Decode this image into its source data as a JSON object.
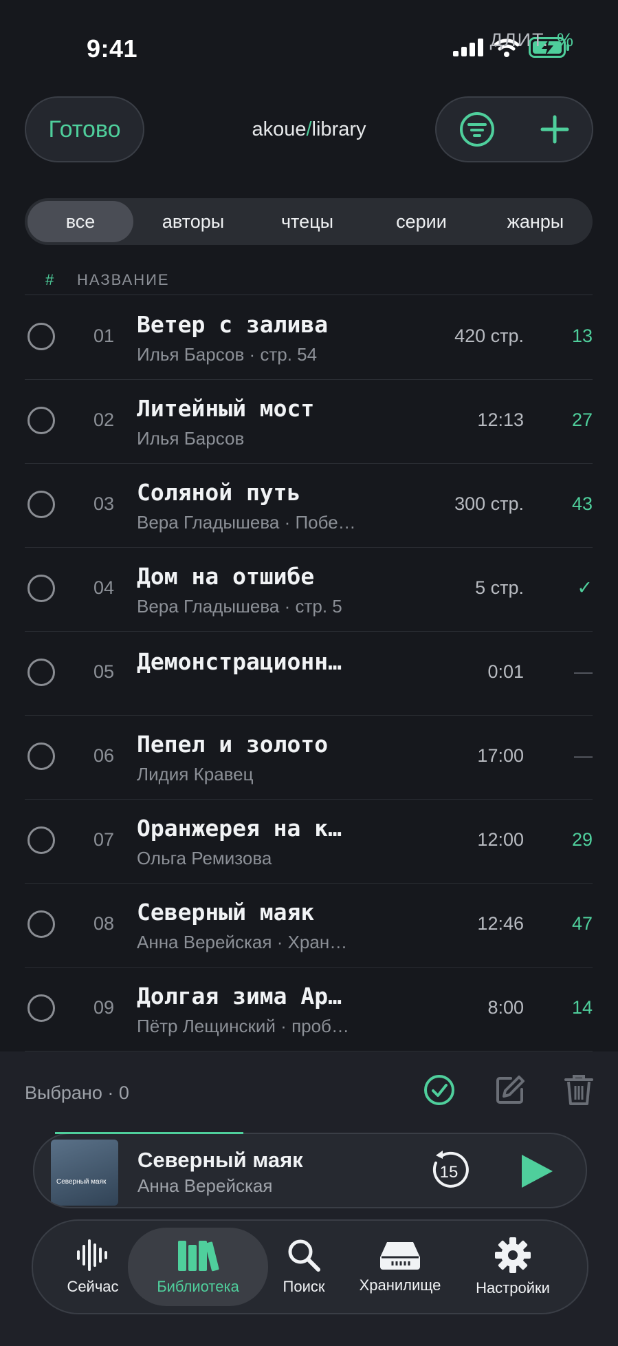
{
  "status": {
    "time": "9:41"
  },
  "header": {
    "done_label": "Готово",
    "path_root": "akoue",
    "path_sep": "/",
    "path_leaf": "library"
  },
  "segments": [
    {
      "label": "все",
      "active": true
    },
    {
      "label": "авторы",
      "active": false
    },
    {
      "label": "чтецы",
      "active": false
    },
    {
      "label": "серии",
      "active": false
    },
    {
      "label": "жанры",
      "active": false
    }
  ],
  "columns": {
    "hash": "#",
    "name": "НАЗВАНИЕ",
    "duration": "ДЛИТ.",
    "percent": "%"
  },
  "rows": [
    {
      "num": "01",
      "title": "Ветер с залива",
      "subtitle": "Илья Барсов · стр. 54",
      "duration": "420 стр.",
      "percent": "13"
    },
    {
      "num": "02",
      "title": "Литейный мост",
      "subtitle": "Илья Барсов",
      "duration": "12:13",
      "percent": "27"
    },
    {
      "num": "03",
      "title": "Соляной путь",
      "subtitle": "Вера Гладышева · Побе…",
      "duration": "300 стр.",
      "percent": "43"
    },
    {
      "num": "04",
      "title": "Дом на отшибе",
      "subtitle": "Вера Гладышева · стр. 5",
      "duration": "5 стр.",
      "percent": "✓"
    },
    {
      "num": "05",
      "title": "Демонстрационн…",
      "subtitle": "",
      "duration": "0:01",
      "percent": "—"
    },
    {
      "num": "06",
      "title": "Пепел и золото",
      "subtitle": "Лидия Кравец",
      "duration": "17:00",
      "percent": "—"
    },
    {
      "num": "07",
      "title": "Оранжерея на к…",
      "subtitle": "Ольга Ремизова",
      "duration": "12:00",
      "percent": "29"
    },
    {
      "num": "08",
      "title": "Северный маяк",
      "subtitle": "Анна Верейская · Хран…",
      "duration": "12:46",
      "percent": "47"
    },
    {
      "num": "09",
      "title": "Долгая зима Ар…",
      "subtitle": "Пётр Лещинский · проб…",
      "duration": "8:00",
      "percent": "14"
    }
  ],
  "selection": {
    "label": "Выбрано · 0"
  },
  "player": {
    "title": "Северный маяк",
    "author": "Анна Верейская",
    "cover_text": "Северный маяк",
    "rewind_seconds": "15",
    "progress": 0.38
  },
  "tabs": [
    {
      "label": "Сейчас",
      "icon": "waveform-icon",
      "active": false
    },
    {
      "label": "Библиотека",
      "icon": "books-icon",
      "active": true
    },
    {
      "label": "Поиск",
      "icon": "search-icon",
      "active": false
    },
    {
      "label": "Хранилище",
      "icon": "drive-icon",
      "active": false
    },
    {
      "label": "Настройки",
      "icon": "gear-icon",
      "active": false
    }
  ],
  "colors": {
    "accent": "#4fcf9c",
    "background": "#16181d"
  }
}
